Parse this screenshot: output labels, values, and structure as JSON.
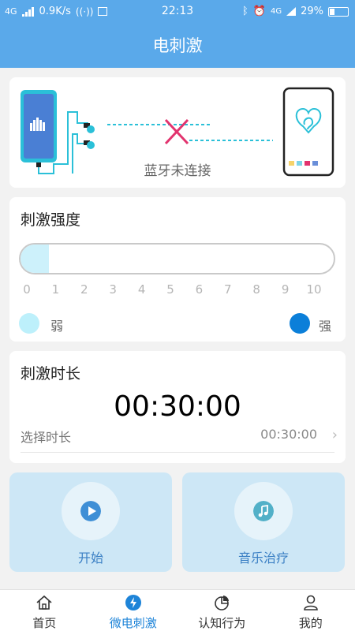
{
  "status_bar": {
    "network": "4G",
    "speed": "0.9K/s",
    "time": "22:13",
    "signal_right": "4G",
    "battery": "29%",
    "battery_level": 0.29
  },
  "header": {
    "title": "电刺激"
  },
  "connection": {
    "status_text": "蓝牙未连接"
  },
  "intensity": {
    "title": "刺激强度",
    "ticks": [
      "0",
      "1",
      "2",
      "3",
      "4",
      "5",
      "6",
      "7",
      "8",
      "9",
      "10"
    ],
    "level": 0,
    "weak_label": "弱",
    "strong_label": "强"
  },
  "duration": {
    "title": "刺激时长",
    "timer": "00:30:00",
    "select_label": "选择时长",
    "select_value": "00:30:00"
  },
  "actions": {
    "start_label": "开始",
    "music_label": "音乐治疗"
  },
  "tabs": [
    {
      "label": "首页",
      "icon": "home-icon"
    },
    {
      "label": "微电刺激",
      "icon": "lightning-icon",
      "active": true
    },
    {
      "label": "认知行为",
      "icon": "pie-chart-icon"
    },
    {
      "label": "我的",
      "icon": "user-icon"
    }
  ],
  "colors": {
    "primary": "#5aa9ea",
    "accent_blue": "#1e84d8",
    "cyan": "#2bc0d8",
    "error_pink": "#e2336e",
    "button_bg": "#cde7f6"
  }
}
